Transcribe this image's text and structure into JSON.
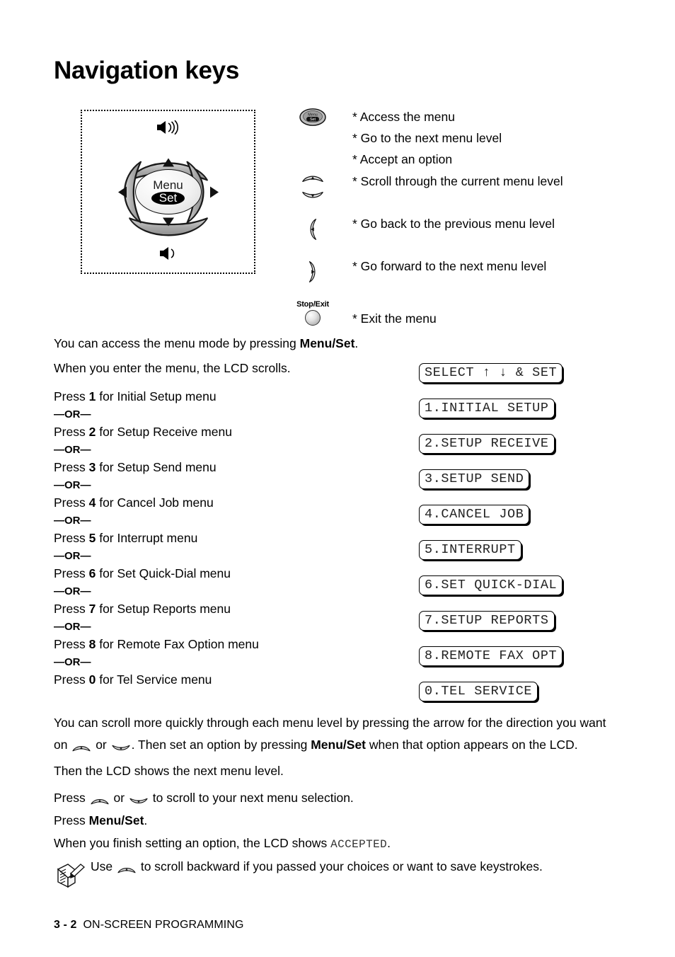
{
  "page": {
    "title": "Navigation keys"
  },
  "keypad": {
    "menu_label": "Menu",
    "set_label": "Set",
    "speaker_up_icon": "speaker-volume-up-icon",
    "speaker_down_icon": "speaker-volume-down-icon",
    "up_arrow_icon": "arrow-up-icon",
    "down_arrow_icon": "arrow-down-icon",
    "left_arrow_icon": "arrow-left-icon",
    "right_arrow_icon": "arrow-right-icon"
  },
  "legend": {
    "menuset": {
      "icon": "menu-set-button-icon",
      "lines": [
        "* Access the menu",
        "* Go to the next menu level",
        "* Accept an option"
      ]
    },
    "updown": {
      "icon_up": "scroll-up-key-icon",
      "icon_down": "scroll-down-key-icon",
      "text": "* Scroll through the current menu level"
    },
    "left": {
      "icon": "left-key-icon",
      "text": "* Go back to the previous menu level"
    },
    "right": {
      "icon": "right-key-icon",
      "text": "* Go forward to the next menu level"
    },
    "stopexit": {
      "icon": "stop-exit-button-icon",
      "label": "Stop/Exit",
      "text": "* Exit the menu"
    }
  },
  "intro": {
    "line1_pre": "You can access the menu mode by pressing ",
    "line1_bold": "Menu/Set",
    "line1_post": ".",
    "line2": "When you enter the menu, the LCD scrolls."
  },
  "press_list": [
    {
      "pre": "Press ",
      "key": "1",
      "post": " for Initial Setup menu",
      "or": "—OR—"
    },
    {
      "pre": "Press ",
      "key": "2",
      "post": " for Setup Receive menu",
      "or": "—OR—"
    },
    {
      "pre": "Press ",
      "key": "3",
      "post": " for Setup Send menu",
      "or": "—OR—"
    },
    {
      "pre": "Press ",
      "key": "4",
      "post": " for Cancel Job menu",
      "or": "—OR—"
    },
    {
      "pre": "Press ",
      "key": "5",
      "post": " for Interrupt menu",
      "or": "—OR—"
    },
    {
      "pre": "Press ",
      "key": "6",
      "post": " for Set Quick-Dial menu",
      "or": "—OR—"
    },
    {
      "pre": "Press ",
      "key": "7",
      "post": " for Setup Reports menu",
      "or": "—OR—"
    },
    {
      "pre": "Press ",
      "key": "8",
      "post": " for Remote Fax Option menu",
      "or": "—OR—"
    },
    {
      "pre": "Press ",
      "key": "0",
      "post": " for Tel Service menu",
      "or": ""
    }
  ],
  "lcd_screens": [
    "SELECT ↑ ↓ & SET",
    "1.INITIAL SETUP",
    "2.SETUP RECEIVE",
    "3.SETUP SEND",
    "4.CANCEL JOB",
    "5.INTERRUPT",
    "6.SET QUICK-DIAL",
    "7.SETUP REPORTS",
    "8.REMOTE FAX OPT",
    "0.TEL SERVICE"
  ],
  "lower": {
    "scroll_para_1": "You can scroll more quickly through each menu level by pressing the arrow for the direction you want on ",
    "scroll_para_2": " or ",
    "scroll_para_3": ". Then set an option by pressing ",
    "scroll_para_bold": "Menu/Set",
    "scroll_para_4": " when that option appears on the LCD.",
    "scroll_para_5": "Then the LCD shows the next menu level.",
    "press_scroll_1": "Press ",
    "press_scroll_2": " or ",
    "press_scroll_3": " to scroll to your next menu selection.",
    "press_menuset_pre": "Press ",
    "press_menuset_bold": "Menu/Set",
    "press_menuset_post": ".",
    "accepted_pre": "When you finish setting an option, the LCD shows ",
    "accepted_mono": "ACCEPTED",
    "accepted_post": "."
  },
  "note": {
    "icon": "note-pad-pencil-icon",
    "text_1": "Use ",
    "text_2": " to scroll backward if you passed your choices or want to save keystrokes."
  },
  "footer": {
    "page_number": "3 - 2",
    "section": "ON-SCREEN PROGRAMMING"
  },
  "colors": {
    "key_gray": "#a8a8a8",
    "key_gray_light": "#d6d6d6",
    "text": "#000000",
    "lcd_text": "#222222"
  }
}
